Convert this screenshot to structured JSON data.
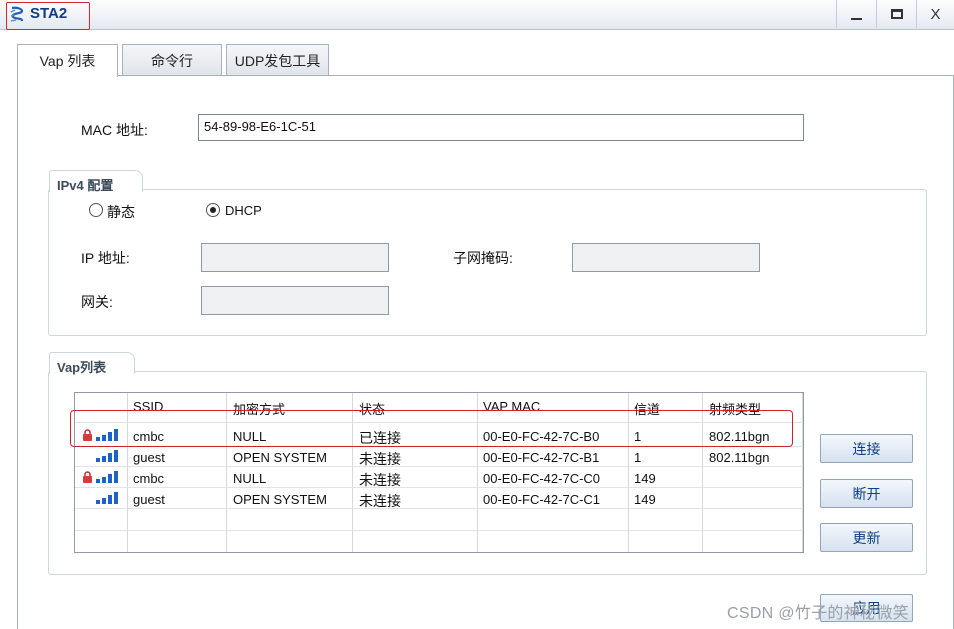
{
  "window": {
    "title": "STA2",
    "controls": {
      "minimize": "",
      "maximize": "",
      "close": "X"
    }
  },
  "tabs": [
    {
      "label": "Vap 列表",
      "active": true
    },
    {
      "label": "命令行",
      "active": false
    },
    {
      "label": "UDP发包工具",
      "active": false
    }
  ],
  "mac": {
    "label": "MAC 地址:",
    "value": "54-89-98-E6-1C-51"
  },
  "ipv4": {
    "group_title": "IPv4 配置",
    "mode_static": "静态",
    "mode_dhcp": "DHCP",
    "selected_mode": "DHCP",
    "ip_label": "IP 地址:",
    "subnet_label": "子网掩码:",
    "gateway_label": "网关:",
    "ip_value": "",
    "subnet_value": "",
    "gateway_value": ""
  },
  "vap": {
    "group_title": "Vap列表",
    "columns": [
      "SSID",
      "加密方式",
      "状态",
      "VAP MAC",
      "信道",
      "射频类型"
    ],
    "rows": [
      {
        "locked": true,
        "ssid": "cmbc",
        "encryption": "NULL",
        "status": "已连接",
        "mac": "00-E0-FC-42-7C-B0",
        "channel": "1",
        "radio": "802.11bgn"
      },
      {
        "locked": false,
        "ssid": "guest",
        "encryption": "OPEN SYSTEM",
        "status": "未连接",
        "mac": "00-E0-FC-42-7C-B1",
        "channel": "1",
        "radio": "802.11bgn"
      },
      {
        "locked": true,
        "ssid": "cmbc",
        "encryption": "NULL",
        "status": "未连接",
        "mac": "00-E0-FC-42-7C-C0",
        "channel": "149",
        "radio": ""
      },
      {
        "locked": false,
        "ssid": "guest",
        "encryption": "OPEN SYSTEM",
        "status": "未连接",
        "mac": "00-E0-FC-42-7C-C1",
        "channel": "149",
        "radio": ""
      }
    ]
  },
  "buttons": {
    "connect": "连接",
    "disconnect": "断开",
    "refresh": "更新",
    "apply": "应用"
  },
  "watermark": "CSDN @竹子的神秘微笑",
  "colors": {
    "accent": "#1d62c6",
    "highlight": "#c7272b",
    "title": "#0f3b86"
  }
}
